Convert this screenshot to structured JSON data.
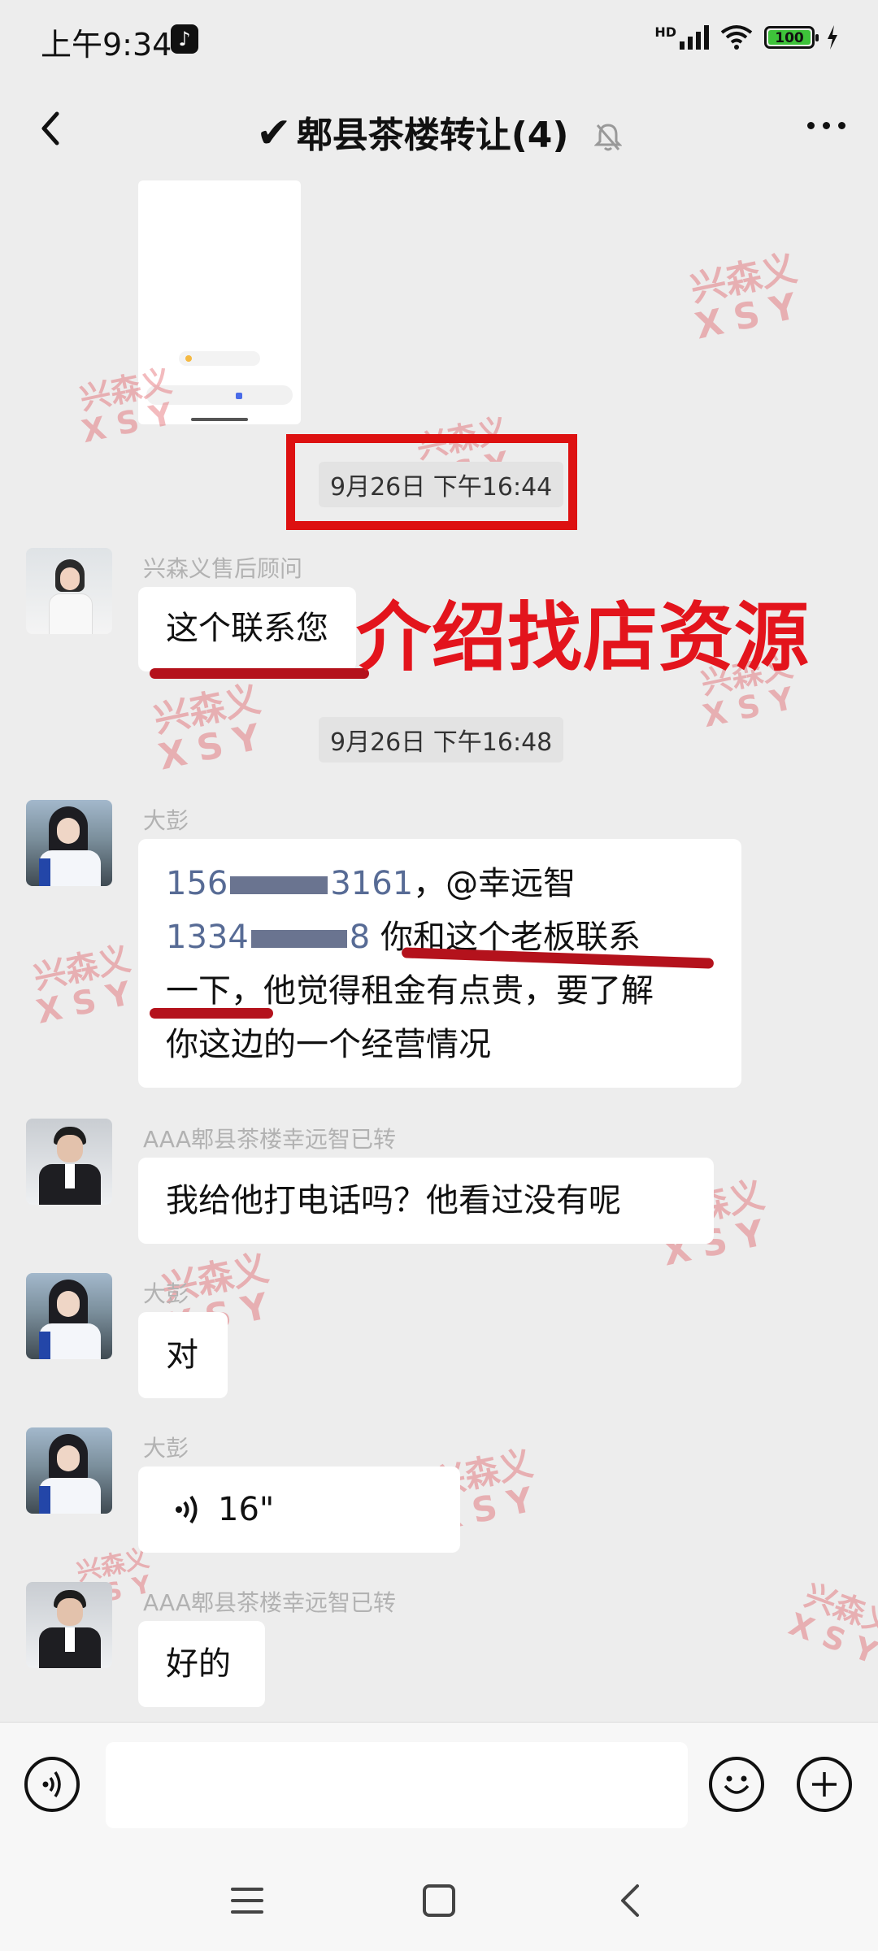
{
  "status_bar": {
    "time": "上午9:34",
    "tiktok_glyph": "♪",
    "hd_label": "HD",
    "battery": "100"
  },
  "header": {
    "check_glyph": "✔",
    "title": "郫县茶楼转让(4)"
  },
  "messages": {
    "timestamp_1": "9月26日 下午16:44",
    "msg1": {
      "sender": "兴森义售后顾问",
      "text": "这个联系您"
    },
    "overlay_text": "介绍找店资源",
    "timestamp_2": "9月26日 下午16:48",
    "msg2": {
      "sender": "大彭",
      "phone_1_start": "156",
      "phone_1_end": "3161",
      "mention": "，@幸远智",
      "phone_2_start": "1334",
      "phone_2_end": "8",
      "line2_text": " 你和这个老板联系",
      "line3": "一下，他觉得租金有点贵，要了解",
      "line4": "你这边的一个经营情况"
    },
    "msg3": {
      "sender": "AAA郫县茶楼幸远智已转",
      "text": "我给他打电话吗？他看过没有呢"
    },
    "msg4": {
      "sender": "大彭",
      "text": "对"
    },
    "msg5": {
      "sender": "大彭",
      "voice_duration": "16\""
    },
    "msg6": {
      "sender": "AAA郫县茶楼幸远智已转",
      "text": "好的"
    }
  },
  "watermark": {
    "line1": "兴森义",
    "line2": "XSY"
  },
  "input": {
    "value": ""
  },
  "colors": {
    "accent_red": "#e3141c",
    "link_blue": "#576b95",
    "background": "#ededed"
  }
}
